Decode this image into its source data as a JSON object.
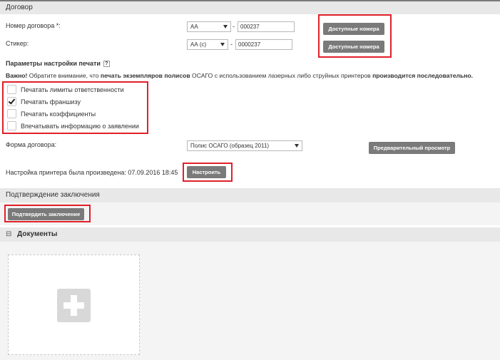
{
  "contract_section": {
    "title": "Договор",
    "contract_number_label": "Номер договора *:",
    "contract_series": "АА",
    "contract_number": "000237",
    "sticker_label": "Стикер:",
    "sticker_series": "АА (с)",
    "sticker_number": "0000237",
    "dash": "-",
    "available_numbers_label": "Доступные номера"
  },
  "print_settings": {
    "title": "Параметры настройки печати",
    "help": "?",
    "note_bold_start": "Важно!",
    "note_text_1": " Обратите внимание, что ",
    "note_bold_middle": "печать экземпляров полисов",
    "note_text_2": " ОСАГО с использованием лазерных либо струйных принтеров ",
    "note_bold_end": "производится последовательно.",
    "options": [
      {
        "label": "Печатать лимиты ответственности",
        "checked": false
      },
      {
        "label": "Печатать франшизу",
        "checked": true
      },
      {
        "label": "Печатать коэффициенты",
        "checked": false
      },
      {
        "label": "Впечатывать информацию о заявлении",
        "checked": false
      }
    ]
  },
  "form": {
    "label": "Форма договора:",
    "selected": "Полис ОСАГО (образец 2011)",
    "preview_label": "Предварительный просмотр"
  },
  "printer": {
    "status_text": "Настройка принтера была произведена: 07.09.2016 18:45",
    "configure_label": "Настроить"
  },
  "confirmation": {
    "title": "Подтверждение заключения",
    "confirm_label": "Подтвердить заключение"
  },
  "documents": {
    "title": "Документы",
    "collapse_symbol": "⊟"
  },
  "colors": {
    "highlight": "#e0202a",
    "button": "#7a7a7a",
    "section_bar": "#e8e8e8"
  }
}
